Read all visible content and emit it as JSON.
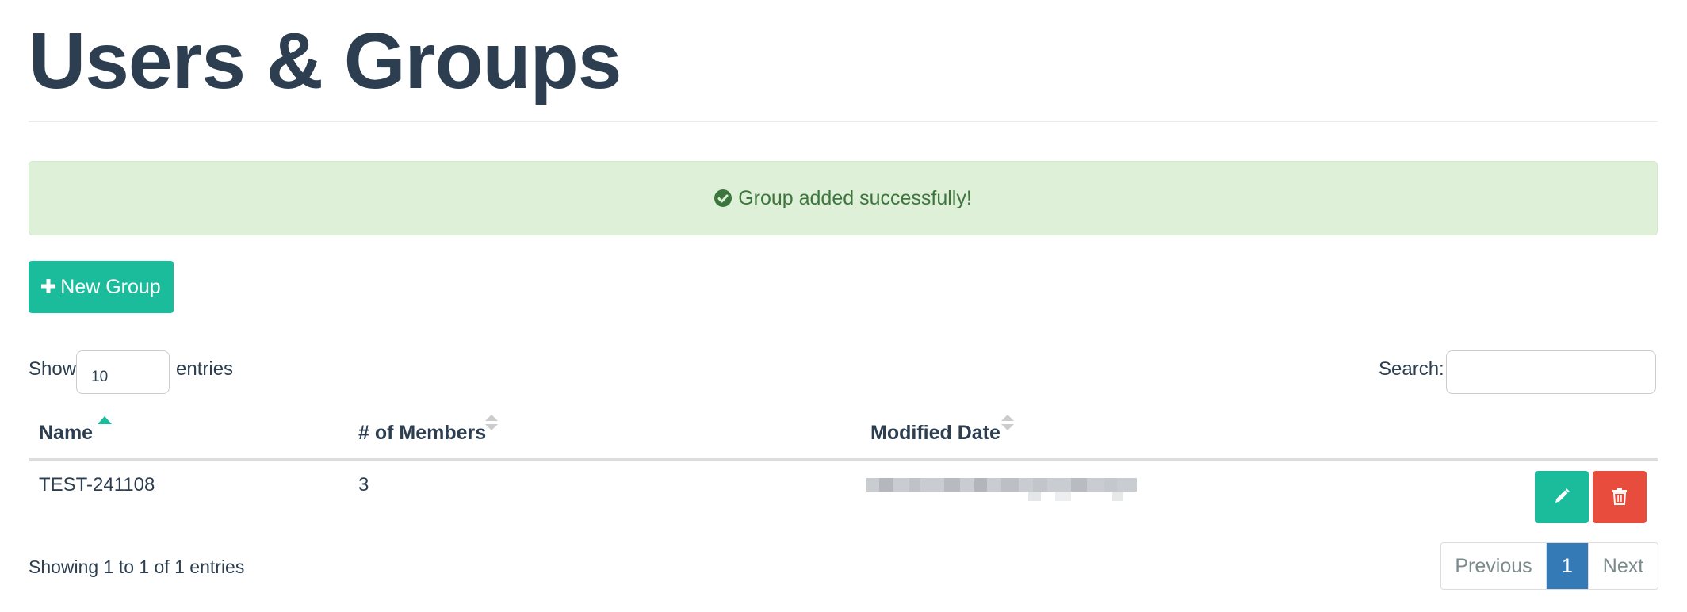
{
  "page": {
    "title": "Users & Groups"
  },
  "alert": {
    "message": "Group added successfully!",
    "icon": "check-circle-icon",
    "color": "#3c763d",
    "background": "#dff0d8"
  },
  "toolbar": {
    "new_group_label": "New Group",
    "new_group_icon": "plus-icon",
    "accent": "#1abc9c"
  },
  "table_controls": {
    "show_label": "Show",
    "page_length": "10",
    "entries_label": "entries",
    "search_label": "Search:",
    "search_value": ""
  },
  "table": {
    "columns": [
      "Name",
      "# of Members",
      "Modified Date"
    ],
    "sorted_column": "Name",
    "sort_direction": "ascending",
    "rows": [
      {
        "name": "TEST-241108",
        "members": "3",
        "modified_date": "[blurred]"
      }
    ],
    "row_actions": [
      {
        "name": "edit",
        "icon": "pencil-icon",
        "color": "#1abc9c"
      },
      {
        "name": "delete",
        "icon": "trash-icon",
        "color": "#e74c3c"
      }
    ]
  },
  "footer": {
    "info": "Showing 1 to 1 of 1 entries",
    "pagination": {
      "previous": "Previous",
      "current": "1",
      "next": "Next",
      "active_color": "#337ab7"
    }
  }
}
